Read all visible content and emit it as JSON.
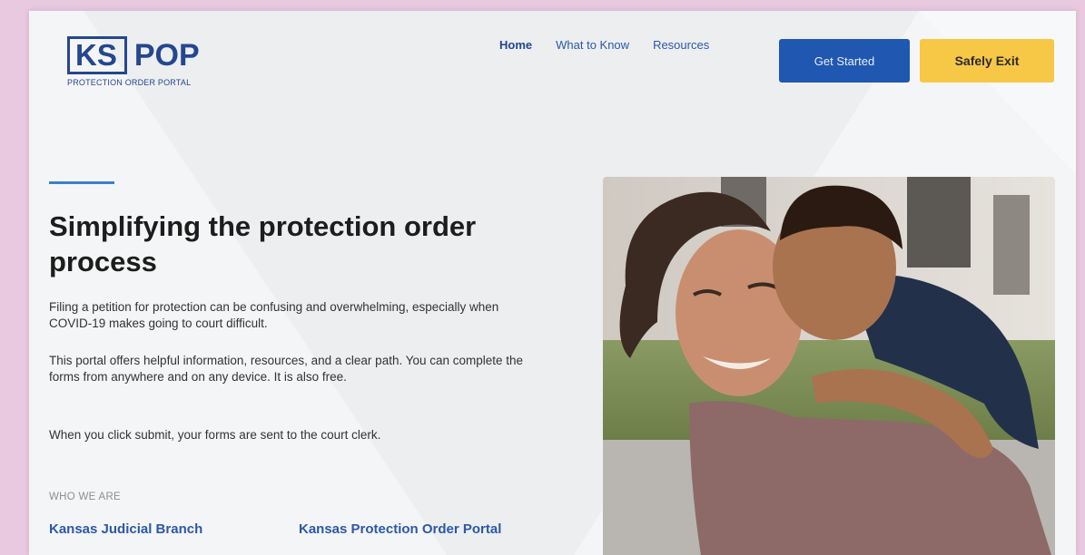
{
  "header": {
    "logo": {
      "ks": "KS",
      "pop": "POP",
      "subtitle": "PROTECTION ORDER PORTAL"
    },
    "nav": [
      {
        "label": "Home",
        "active": true
      },
      {
        "label": "What to Know",
        "active": false
      },
      {
        "label": "Resources",
        "active": false
      }
    ],
    "get_started_label": "Get Started",
    "safely_exit_label": "Safely Exit"
  },
  "hero": {
    "title": "Simplifying the protection order process",
    "paragraphs": [
      "Filing a petition for protection can be confusing and overwhelming, especially when COVID-19 makes going to court difficult.",
      "This portal offers helpful information, resources, and a clear path. You can complete the forms from anywhere and on any device. It is also free.",
      "When you click submit, your forms are sent to the court clerk."
    ],
    "who_label": "WHO WE ARE",
    "links": [
      "Kansas Judicial Branch",
      "Kansas Protection Order Portal"
    ]
  },
  "colors": {
    "brand": "#24478f",
    "link": "#2c58a8",
    "primary_button": "#2057b0",
    "exit_button": "#f7c746",
    "accent_line": "#3d7fd0"
  }
}
